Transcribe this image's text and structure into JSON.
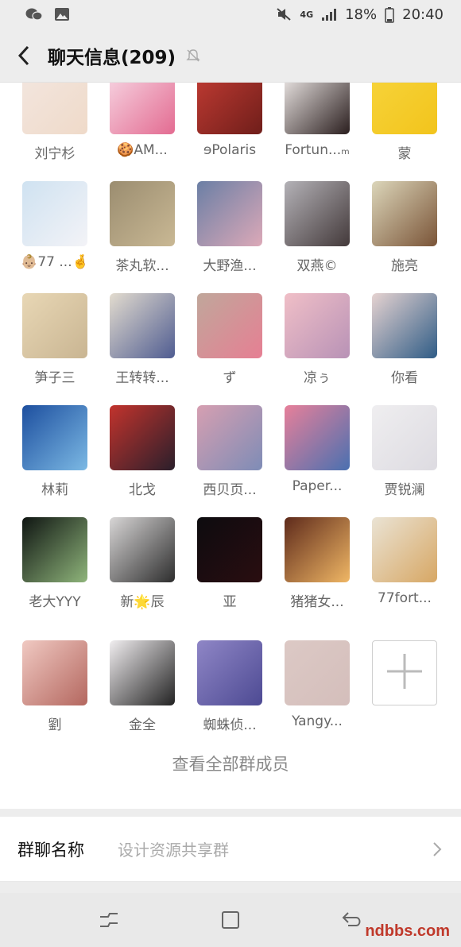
{
  "status_bar": {
    "battery": "18%",
    "time": "20:40",
    "network": "4G"
  },
  "header": {
    "title": "聊天信息(209)"
  },
  "members": [
    {
      "name": "刘宁杉",
      "colors": [
        "#f3e6df",
        "#efdac9"
      ]
    },
    {
      "name": "🍪AM...",
      "colors": [
        "#f7d7e4",
        "#e36b91"
      ]
    },
    {
      "name": "ɘPolaris",
      "colors": [
        "#c23b33",
        "#6f1e1a"
      ]
    },
    {
      "name": "Fortun...ₘ",
      "colors": [
        "#f5f0ee",
        "#2a1e1e"
      ]
    },
    {
      "name": "蒙",
      "colors": [
        "#f7d43b",
        "#f2c41c"
      ]
    },
    {
      "name": "👶🏼77 ...🤞",
      "colors": [
        "#cfe2f1",
        "#f3f3f7"
      ]
    },
    {
      "name": "茶丸软...",
      "colors": [
        "#9b8d70",
        "#c9b894"
      ]
    },
    {
      "name": "大野渔...",
      "colors": [
        "#6b7fa5",
        "#dca9b8"
      ]
    },
    {
      "name": "双燕©",
      "colors": [
        "#b4b2b7",
        "#43393a"
      ]
    },
    {
      "name": "施亮",
      "colors": [
        "#dcd6ba",
        "#7a5437"
      ]
    },
    {
      "name": "笋子三",
      "colors": [
        "#e8d7b5",
        "#c9b592"
      ]
    },
    {
      "name": "王转转...",
      "colors": [
        "#e3dccf",
        "#4f5c91"
      ]
    },
    {
      "name": "ず",
      "colors": [
        "#c0a79b",
        "#e67f93"
      ]
    },
    {
      "name": "凉ぅ",
      "colors": [
        "#f0bfc7",
        "#b892b6"
      ]
    },
    {
      "name": "你看",
      "colors": [
        "#e6d3d1",
        "#2f5c86"
      ]
    },
    {
      "name": "林莉",
      "colors": [
        "#1d4f9f",
        "#7cb9e4"
      ]
    },
    {
      "name": "北戈",
      "colors": [
        "#c2332d",
        "#2a1f2b"
      ]
    },
    {
      "name": "西贝页...",
      "colors": [
        "#d69fb1",
        "#7e8cb6"
      ]
    },
    {
      "name": "Paper...",
      "colors": [
        "#e7809a",
        "#4a70b0"
      ]
    },
    {
      "name": "贾锐澜",
      "colors": [
        "#efeef0",
        "#dddbe1"
      ]
    },
    {
      "name": "老大YYY",
      "colors": [
        "#0f1512",
        "#8fb57b"
      ]
    },
    {
      "name": "新🌟辰",
      "colors": [
        "#d8d6d6",
        "#2d2d2d"
      ]
    },
    {
      "name": "亚",
      "colors": [
        "#0d0c0f",
        "#2a0d10"
      ]
    },
    {
      "name": "猪猪女...",
      "colors": [
        "#5e2a1b",
        "#f0b765"
      ]
    },
    {
      "name": "77fort...",
      "colors": [
        "#eae3d4",
        "#d7a764"
      ]
    },
    {
      "name": "劉",
      "colors": [
        "#f0c9c2",
        "#b4675f"
      ]
    },
    {
      "name": "金全",
      "colors": [
        "#f1eef0",
        "#222222"
      ]
    },
    {
      "name": "蜘蛛侦...",
      "colors": [
        "#8f86c6",
        "#4d4a93"
      ]
    },
    {
      "name": "Yangy...",
      "colors": [
        "#dcc9c5",
        "#d4bebb"
      ]
    }
  ],
  "view_all_label": "查看全部群成员",
  "group_name_setting": {
    "label": "群聊名称",
    "value": "设计资源共享群"
  },
  "watermark": "ndbbs.com"
}
